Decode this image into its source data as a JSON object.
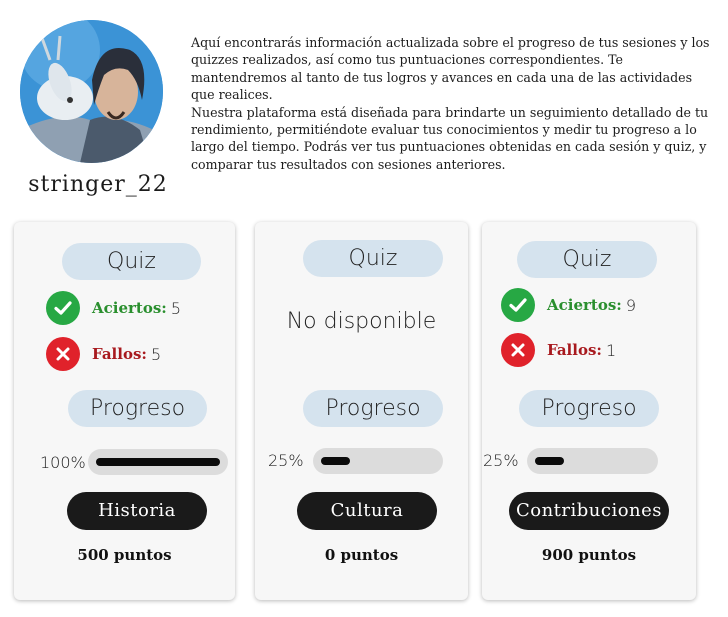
{
  "profile": {
    "username": "stringer_22",
    "avatar_icon": "avatar-illustration"
  },
  "intro": {
    "paragraph1": "Aquí encontrarás información actualizada sobre el progreso de tus sesiones y los quizzes realizados, así como tus puntuaciones correspondientes. Te mantendremos al tanto de tus logros y avances en cada una de las actividades que realices.",
    "paragraph2": "Nuestra plataforma está diseñada para brindarte un seguimiento detallado de tu rendimiento, permitiéndote evaluar tus conocimientos y medir tu progreso a lo largo del tiempo. Podrás ver tus puntuaciones obtenidas en cada sesión y quiz, y comparar tus resultados con sesiones anteriores."
  },
  "cards": [
    {
      "quiz_label": "Quiz",
      "correct_label": "Aciertos:",
      "correct_count": "5",
      "wrong_label": "Fallos:",
      "wrong_count": "5",
      "progress_label": "Progreso",
      "progress_text": "100%",
      "progress_value": 1.0,
      "category": "Historia",
      "points": "500 puntos"
    },
    {
      "quiz_label": "Quiz",
      "unavailable": "No disponible",
      "progress_label": "Progreso",
      "progress_text": "25%",
      "progress_value": 0.25,
      "category": "Cultura",
      "points": "0 puntos"
    },
    {
      "quiz_label": "Quiz",
      "correct_label": "Aciertos:",
      "correct_count": "9",
      "wrong_label": "Fallos:",
      "wrong_count": "1",
      "progress_label": "Progreso",
      "progress_text": "25%",
      "progress_value": 0.25,
      "category": "Contribuciones",
      "points": "900 puntos"
    }
  ],
  "colors": {
    "pill_bg": "#d5e3ee",
    "correct": "#27a844",
    "wrong": "#e0222b",
    "progress_fill": "#0b0b0b",
    "button_bg": "#1a1a1a"
  }
}
